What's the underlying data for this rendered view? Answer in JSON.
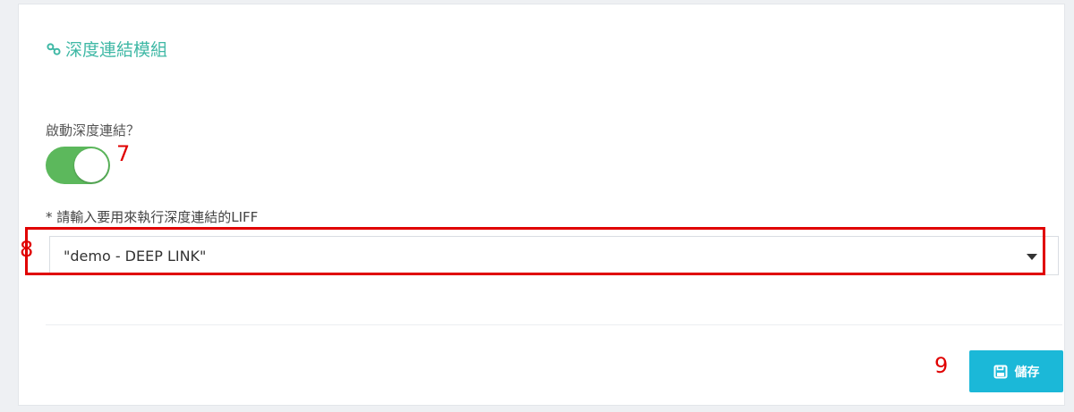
{
  "module": {
    "title": "深度連結模組",
    "icon": "link-icon"
  },
  "enable_toggle": {
    "label": "啟動深度連結？",
    "state": "on",
    "color": "#5cb85c"
  },
  "liff_select": {
    "label": "* 請輸入要用來執行深度連結的LIFF",
    "value": "\"demo - DEEP LINK\"",
    "icon": "caret-down-icon"
  },
  "save_button": {
    "label": "儲存",
    "icon": "floppy-disk-icon",
    "color": "#1bb8d8"
  },
  "annotations": {
    "toggle_marker": "7",
    "select_marker": "8",
    "save_marker": "9",
    "color": "#e00000"
  },
  "colors": {
    "accent_title": "#3fb8a5"
  }
}
